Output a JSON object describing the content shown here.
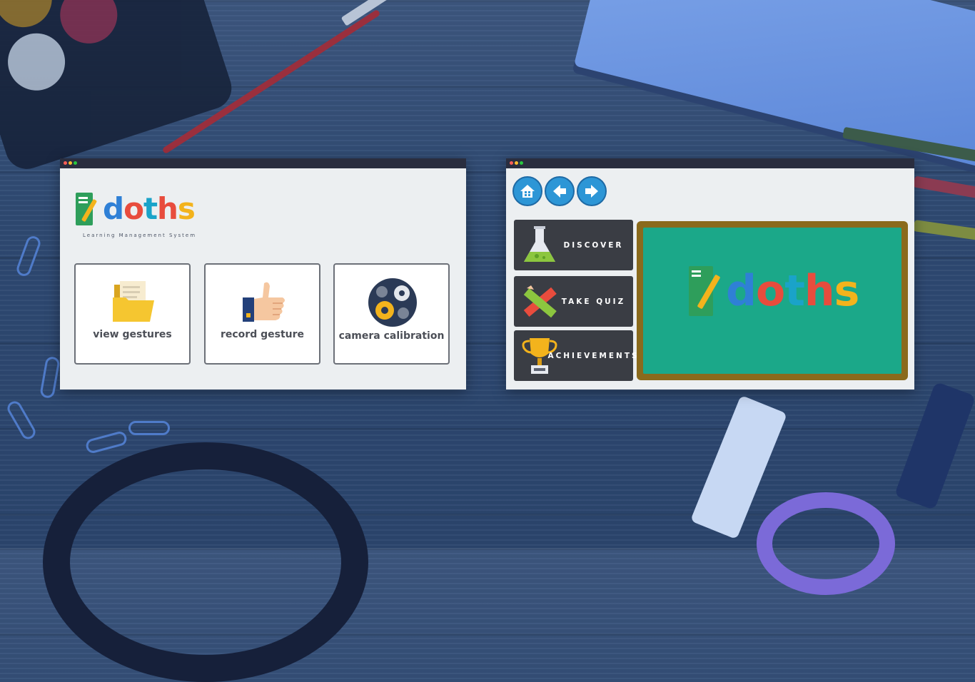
{
  "left_window": {
    "logo": {
      "word": [
        "d",
        "o",
        "t",
        "h",
        "s"
      ],
      "subtitle": "Learning Management System"
    },
    "cards": [
      {
        "label": "view gestures",
        "icon": "folder-icon"
      },
      {
        "label": "record gesture",
        "icon": "thumbs-up-icon"
      },
      {
        "label": "camera calibration",
        "icon": "gears-icon"
      }
    ]
  },
  "right_window": {
    "nav": [
      {
        "icon": "home-icon"
      },
      {
        "icon": "arrow-left-icon"
      },
      {
        "icon": "arrow-right-icon"
      }
    ],
    "menu": [
      {
        "label": "DISCOVER",
        "icon": "flask-icon"
      },
      {
        "label": "TAKE QUIZ",
        "icon": "pencil-ruler-icon"
      },
      {
        "label": "ACHIEVEMENTS",
        "icon": "trophy-icon"
      }
    ],
    "board_logo": {
      "word": [
        "d",
        "o",
        "t",
        "h",
        "s"
      ]
    }
  },
  "colors": {
    "background": "#2f4a73",
    "window": "#eceff1",
    "titlebar": "#2a2e3f",
    "nav_button": "#2d96d6",
    "menu_tile": "#3a3d44",
    "chalkboard": "#1ba889",
    "chalkboard_frame": "#8a6a1c",
    "logo_letters": [
      "#2e9e5b",
      "#2f80d6",
      "#e84c3d",
      "#f3b31c",
      "#1aa3c9"
    ]
  }
}
